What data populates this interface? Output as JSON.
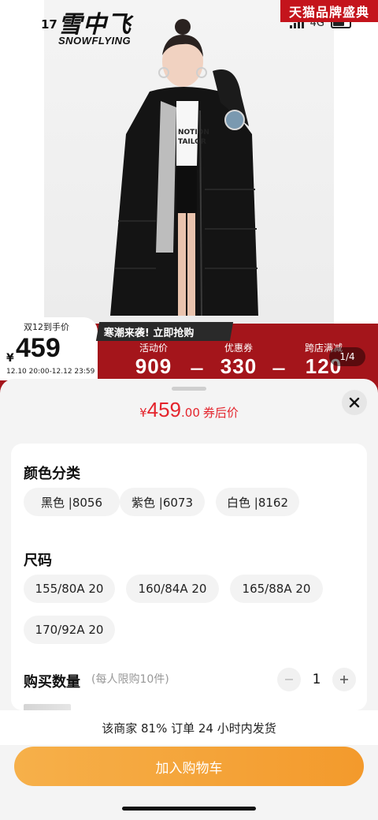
{
  "status": {
    "time": "17",
    "network": "4G"
  },
  "brand": {
    "name": "雪中飞",
    "sub": "SNOWFLYING"
  },
  "tmall_badge": "天猫品牌盛典",
  "price_card": {
    "label": "双12到手价",
    "currency": "¥",
    "price": "459",
    "time_range": "12.10 20:00-12.12 23:59"
  },
  "promo_tag": "寒潮来袭! 立即抢购",
  "stats": [
    {
      "label": "活动价",
      "value": "909"
    },
    {
      "label": "优惠券",
      "value": "330"
    },
    {
      "label": "跨店满减",
      "value": "120"
    }
  ],
  "image_counter": "1/4",
  "sheet": {
    "price_currency": "¥",
    "price_int": "459",
    "price_dec": ".00",
    "price_suffix": "券后价",
    "color_title": "颜色分类",
    "colors": [
      "黑色 |8056",
      "紫色 |6073",
      "白色 |8162"
    ],
    "size_title": "尺码",
    "sizes": [
      "155/80A 20",
      "160/84A 20",
      "165/88A 20",
      "170/92A 20"
    ],
    "qty_title": "购买数量",
    "qty_note": "(每人限购10件)",
    "qty_value": "1",
    "shipping": "该商家 81% 订单 24 小时内发货",
    "cart_button": "加入购物车"
  },
  "colors": {
    "accent": "#e4242c",
    "hero_red": "#a4151b",
    "cart_orange": "#f39a2c"
  }
}
